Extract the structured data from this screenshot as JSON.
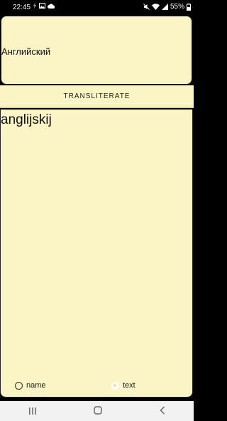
{
  "status": {
    "time": "22:45",
    "battery": "55%"
  },
  "input": {
    "value": "Английский"
  },
  "translit_button": {
    "label": "TRANSLITERATE"
  },
  "result": {
    "text": "anglijskij"
  },
  "mode": {
    "options": [
      {
        "label": "name",
        "selected": false
      },
      {
        "label": "text",
        "selected": true
      }
    ]
  },
  "nav": {
    "recents": "|||",
    "home": "○",
    "back": "<"
  }
}
